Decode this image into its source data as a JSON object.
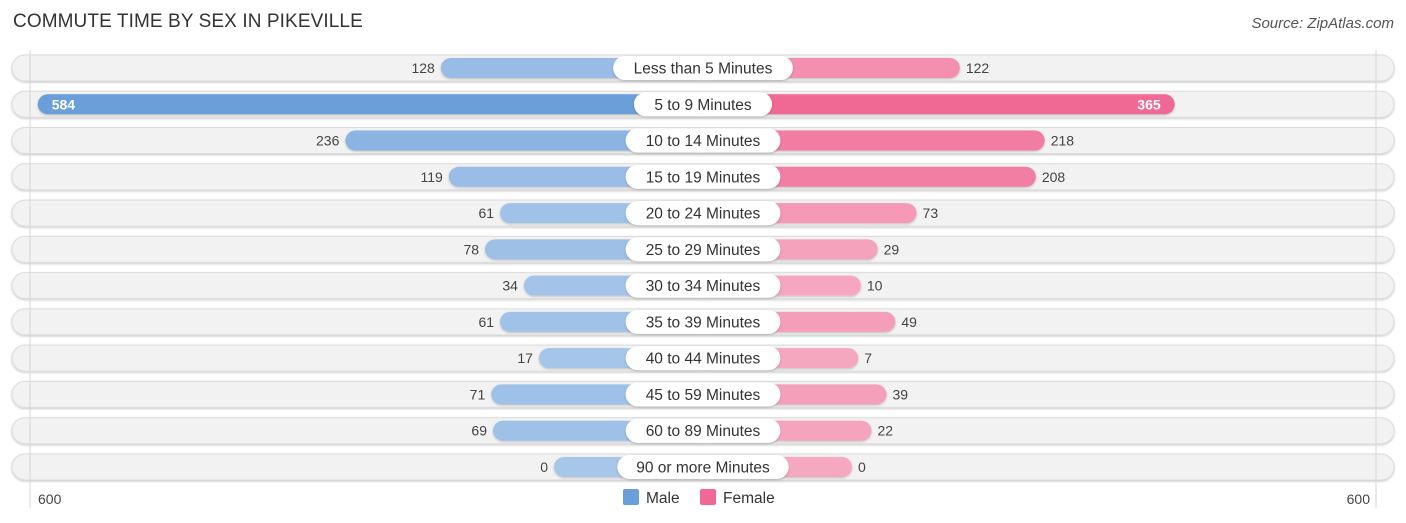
{
  "header": {
    "title": "COMMUTE TIME BY SEX IN PIKEVILLE",
    "source": "Source: ZipAtlas.com"
  },
  "colors": {
    "male": "#6a9fd9",
    "male_light": "#a7c6ea",
    "female": "#f06894",
    "female_light": "#f6a8c1",
    "track": "#f2f2f2"
  },
  "chart_data": {
    "type": "bar",
    "orientation": "horizontal-diverging",
    "title": "COMMUTE TIME BY SEX IN PIKEVILLE",
    "categories": [
      "Less than 5 Minutes",
      "5 to 9 Minutes",
      "10 to 14 Minutes",
      "15 to 19 Minutes",
      "20 to 24 Minutes",
      "25 to 29 Minutes",
      "30 to 34 Minutes",
      "35 to 39 Minutes",
      "40 to 44 Minutes",
      "45 to 59 Minutes",
      "60 to 89 Minutes",
      "90 or more Minutes"
    ],
    "series": [
      {
        "name": "Male",
        "values": [
          128,
          584,
          236,
          119,
          61,
          78,
          34,
          61,
          17,
          71,
          69,
          0
        ]
      },
      {
        "name": "Female",
        "values": [
          122,
          365,
          218,
          208,
          73,
          29,
          10,
          49,
          7,
          39,
          22,
          0
        ]
      }
    ],
    "axis": {
      "left_label": "600",
      "right_label": "600",
      "max": 600
    },
    "legend": {
      "position": "bottom-center",
      "items": [
        "Male",
        "Female"
      ]
    },
    "xlabel": "",
    "ylabel": ""
  }
}
